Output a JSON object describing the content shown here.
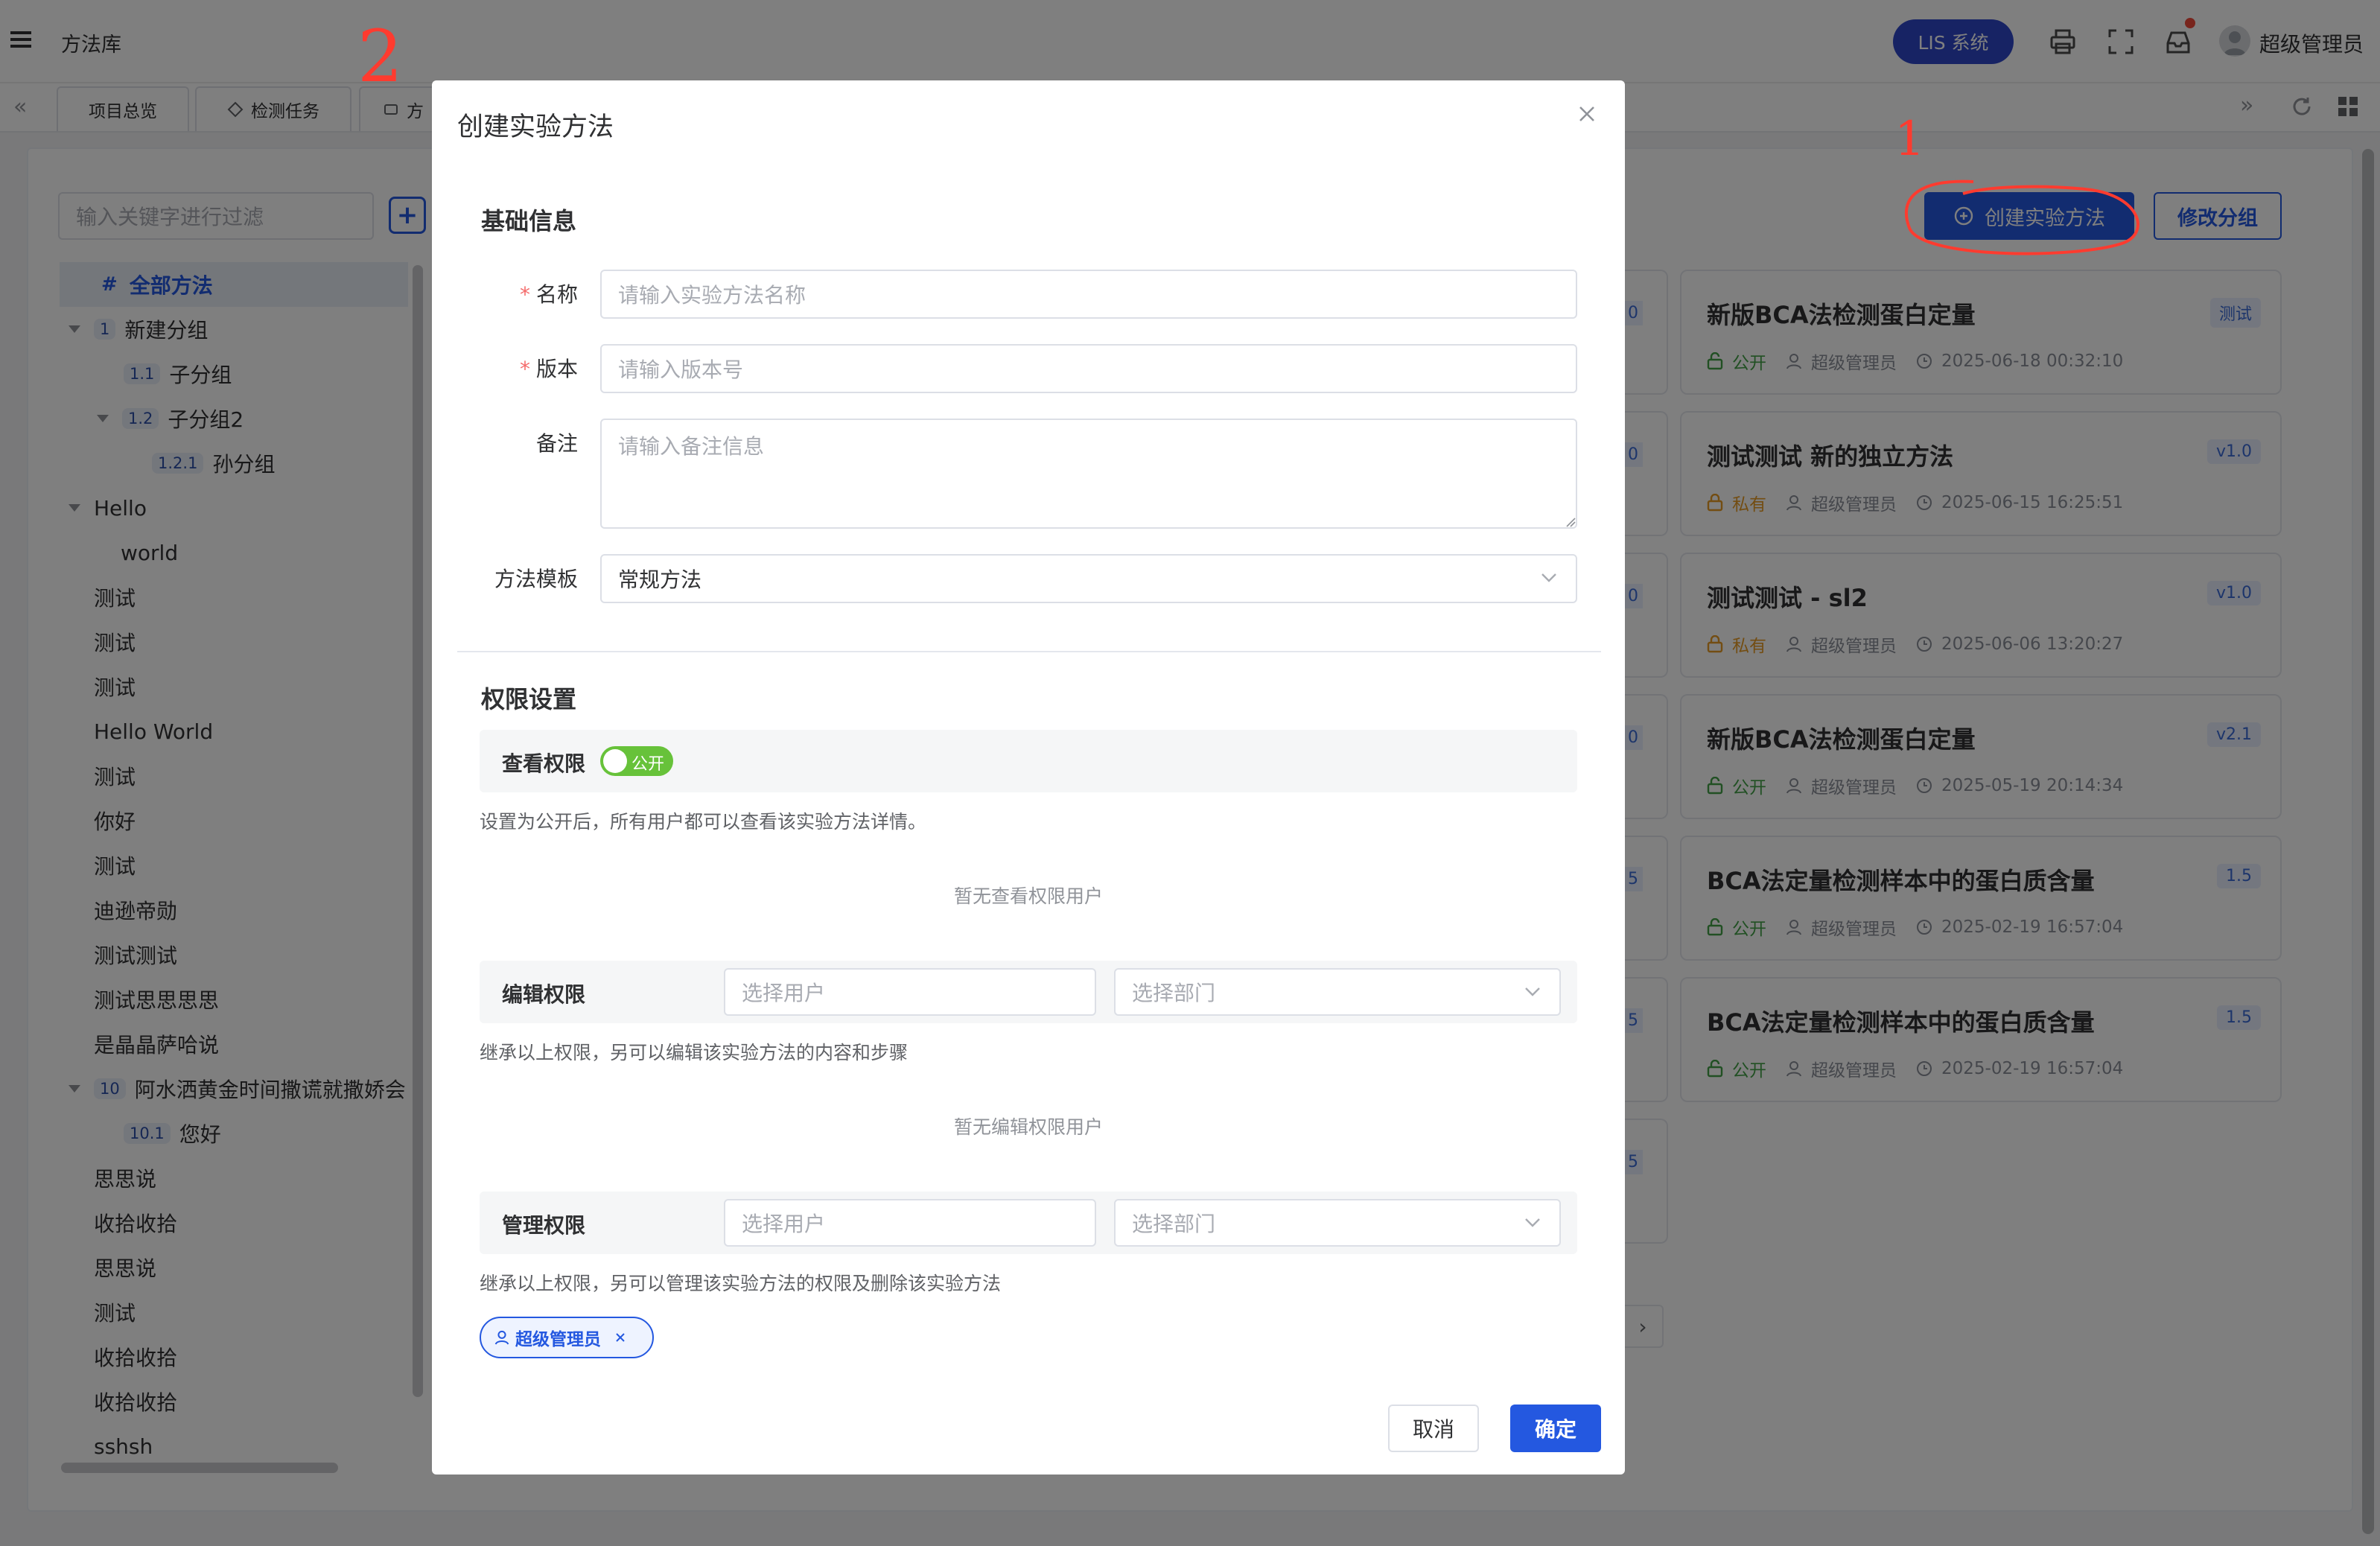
{
  "header": {
    "title": "方法库",
    "system_button": "LIS 系统",
    "user_name": "超级管理员"
  },
  "tabs": [
    {
      "label": "项目总览"
    },
    {
      "label": "检测任务"
    },
    {
      "label": "方"
    }
  ],
  "sidebar": {
    "search_placeholder": "输入关键字进行过滤",
    "all_methods": "全部方法",
    "all_methods_icon": "#",
    "groups": [
      {
        "num": "1",
        "label": "新建分组"
      },
      {
        "num": "1.1",
        "label": "子分组"
      },
      {
        "num": "1.2",
        "label": "子分组2"
      },
      {
        "num": "1.2.1",
        "label": "孙分组"
      },
      {
        "num": "",
        "label": "Hello"
      },
      {
        "num": "",
        "label": "world"
      },
      {
        "num": "",
        "label": "测试"
      },
      {
        "num": "",
        "label": "测试"
      },
      {
        "num": "",
        "label": "测试"
      },
      {
        "num": "",
        "label": "Hello World"
      },
      {
        "num": "",
        "label": "测试"
      },
      {
        "num": "",
        "label": "你好"
      },
      {
        "num": "",
        "label": "测试"
      },
      {
        "num": "",
        "label": "迪逊帝勋"
      },
      {
        "num": "",
        "label": "测试测试"
      },
      {
        "num": "",
        "label": "测试思思思思"
      },
      {
        "num": "",
        "label": "是晶晶萨哈说"
      },
      {
        "num": "10",
        "label": "阿水洒黄金时间撒谎就撒娇会:"
      },
      {
        "num": "10.1",
        "label": "您好"
      },
      {
        "num": "",
        "label": "思思说"
      },
      {
        "num": "",
        "label": "收拾收拾"
      },
      {
        "num": "",
        "label": "思思说"
      },
      {
        "num": "",
        "label": "测试"
      },
      {
        "num": "",
        "label": "收拾收拾"
      },
      {
        "num": "",
        "label": "收拾收拾"
      },
      {
        "num": "",
        "label": "sshsh"
      }
    ]
  },
  "toolbar": {
    "create_button": "创建实验方法",
    "modify_group_button": "修改分组"
  },
  "annotations": {
    "mark_1": "1",
    "mark_2": "2"
  },
  "cards": [
    {
      "title": "新版BCA法检测蛋白定量",
      "badge": "测试",
      "visibility": "公开",
      "owner": "超级管理员",
      "time": "2025-06-18 00:32:10"
    },
    {
      "title": "测试测试 新的独立方法",
      "badge": "v1.0",
      "visibility": "私有",
      "owner": "超级管理员",
      "time": "2025-06-15 16:25:51"
    },
    {
      "title": "测试测试 - sl2",
      "badge": "v1.0",
      "visibility": "私有",
      "owner": "超级管理员",
      "time": "2025-06-06 13:20:27"
    },
    {
      "title": "新版BCA法检测蛋白定量",
      "badge": "v2.1",
      "visibility": "公开",
      "owner": "超级管理员",
      "time": "2025-05-19 20:14:34"
    },
    {
      "title": "BCA法定量检测样本中的蛋白质含量",
      "badge": "1.5",
      "visibility": "公开",
      "owner": "超级管理员",
      "time": "2025-02-19 16:57:04"
    },
    {
      "title": "BCA法定量检测样本中的蛋白质含量",
      "badge": "1.5",
      "visibility": "公开",
      "owner": "超级管理员",
      "time": "2025-02-19 16:57:04"
    }
  ],
  "hidden_cards_badges": [
    "0",
    "0",
    "0",
    "0",
    "5",
    "5",
    "5"
  ],
  "modal": {
    "title": "创建实验方法",
    "basic_section": "基础信息",
    "required_mark": "*",
    "name_label": "名称",
    "name_placeholder": "请输入实验方法名称",
    "version_label": "版本",
    "version_placeholder": "请输入版本号",
    "note_label": "备注",
    "note_placeholder": "请输入备注信息",
    "template_label": "方法模板",
    "template_value": "常规方法",
    "permission_section": "权限设置",
    "view_label": "查看权限",
    "view_toggle_text": "公开",
    "view_toggle_on": true,
    "view_hint": "设置为公开后，所有用户都可以查看该实验方法详情。",
    "view_empty": "暂无查看权限用户",
    "edit_label": "编辑权限",
    "edit_user_placeholder": "选择用户",
    "edit_dept_placeholder": "选择部门",
    "edit_hint": "继承以上权限，另可以编辑该实验方法的内容和步骤",
    "edit_empty": "暂无编辑权限用户",
    "manage_label": "管理权限",
    "manage_user_placeholder": "选择用户",
    "manage_dept_placeholder": "选择部门",
    "manage_hint": "继承以上权限，另可以管理该实验方法的权限及删除该实验方法",
    "manage_tag": "超级管理员",
    "cancel_button": "取消",
    "confirm_button": "确定"
  },
  "colors": {
    "primary": "#2458e0",
    "lis_button": "#2f46c9",
    "toggle_on": "#67c23a",
    "annotation_red": "#ff3b2f"
  }
}
